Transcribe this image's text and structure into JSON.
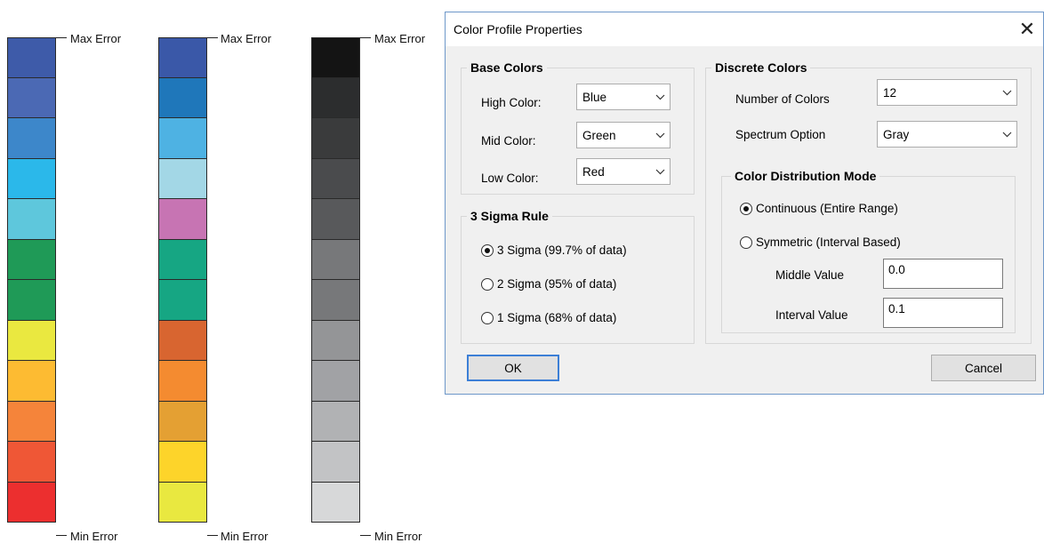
{
  "legends": [
    {
      "max_label": "Max Error",
      "min_label": "Min Error",
      "swatches": [
        "#3e5ba9",
        "#4b69b4",
        "#3d87ca",
        "#2bb8ea",
        "#5ec7dc",
        "#1f9a57",
        "#1f9a57",
        "#eae840",
        "#fdbb32",
        "#f5843a",
        "#ef5736",
        "#ec2f2f"
      ]
    },
    {
      "max_label": "Max Error",
      "min_label": "Min Error",
      "swatches": [
        "#3a58a8",
        "#1f77ba",
        "#4eb2e3",
        "#a3d7e6",
        "#c774b3",
        "#16a683",
        "#16a683",
        "#d86530",
        "#f48b30",
        "#e4a033",
        "#fdd42a",
        "#e9e840"
      ]
    },
    {
      "max_label": "Max Error",
      "min_label": "Min Error",
      "swatches": [
        "#141414",
        "#2c2d2e",
        "#3a3b3c",
        "#4a4b4d",
        "#58595b",
        "#77787a",
        "#77787a",
        "#949597",
        "#a1a2a5",
        "#b1b2b4",
        "#c2c3c5",
        "#d7d8d9"
      ]
    }
  ],
  "dialog": {
    "title": "Color Profile Properties",
    "close_glyph": "✕",
    "base_colors": {
      "title": "Base Colors",
      "high_label": "High Color:",
      "high_value": "Blue",
      "mid_label": "Mid Color:",
      "mid_value": "Green",
      "low_label": "Low Color:",
      "low_value": "Red"
    },
    "sigma": {
      "title": "3 Sigma Rule",
      "options": [
        "3 Sigma (99.7% of data)",
        "2 Sigma (95% of data)",
        "1 Sigma (68% of data)"
      ],
      "selected": 0
    },
    "discrete": {
      "title": "Discrete Colors",
      "num_label": "Number of Colors",
      "num_value": "12",
      "spectrum_label": "Spectrum Option",
      "spectrum_value": "Gray"
    },
    "distribution": {
      "title": "Color Distribution Mode",
      "options": [
        "Continuous (Entire Range)",
        "Symmetric  (Interval Based)"
      ],
      "selected": 0,
      "middle_label": "Middle Value",
      "middle_value": "0.0",
      "interval_label": "Interval Value",
      "interval_value": "0.1"
    },
    "ok_label": "OK",
    "cancel_label": "Cancel"
  }
}
